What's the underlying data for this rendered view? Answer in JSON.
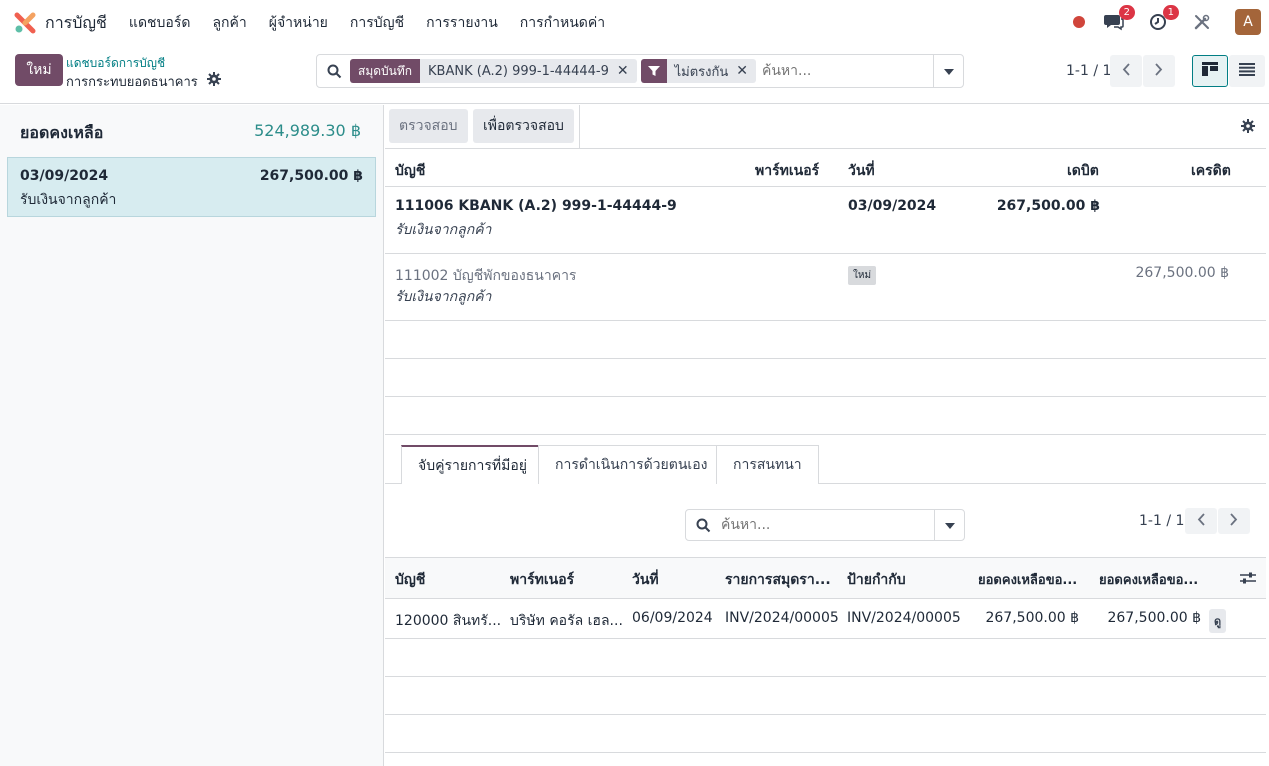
{
  "topbar": {
    "app_title": "การบัญชี",
    "menu": [
      "แดชบอร์ด",
      "ลูกค้า",
      "ผู้จำหน่าย",
      "การบัญชี",
      "การรายงาน",
      "การกำหนดค่า"
    ],
    "messages_count": "2",
    "activities_count": "1",
    "avatar_letter": "A"
  },
  "control": {
    "new_label": "ใหม่",
    "breadcrumb_parent": "แดชบอร์ดการบัญชี",
    "breadcrumb_current": "การกระทบยอดธนาคาร",
    "facets": [
      {
        "label": "สมุดบันทึก",
        "value": "KBANK (A.2) 999-1-44444-9"
      },
      {
        "label": "",
        "value": "ไม่ตรงกัน"
      }
    ],
    "search_placeholder": "ค้นหา...",
    "pager": "1-1 / 1"
  },
  "left": {
    "balance_label": "ยอดคงเหลือ",
    "balance_value": "524,989.30 ฿",
    "statement": {
      "date": "03/09/2024",
      "amount": "267,500.00 ฿",
      "label": "รับเงินจากลูกค้า"
    }
  },
  "right": {
    "btn_validate": "ตรวจสอบ",
    "btn_to_check": "เพื่อตรวจสอบ",
    "headers": {
      "account": "บัญชี",
      "partner": "พาร์ทเนอร์",
      "date": "วันที่",
      "debit": "เดบิต",
      "credit": "เครดิต"
    },
    "rows": [
      {
        "account": "111006 KBANK (A.2) 999-1-44444-9",
        "label": "รับเงินจากลูกค้า",
        "date": "03/09/2024",
        "debit": "267,500.00 ฿",
        "credit": ""
      },
      {
        "account": "111002 บัญชีพักของธนาคาร",
        "label": "รับเงินจากลูกค้า",
        "badge": "ใหม่",
        "debit": "",
        "credit": "267,500.00 ฿"
      }
    ],
    "tabs": [
      "จับคู่รายการที่มีอยู่",
      "การดำเนินการด้วยตนเอง",
      "การสนทนา"
    ],
    "search_placeholder": "ค้นหา...",
    "pager": "1-1 / 1",
    "table2_headers": [
      "บัญชี",
      "พาร์ทเนอร์",
      "วันที่",
      "รายการสมุดรา...",
      "ป้ายกำกับ",
      "ยอดคงเหลือขอ...",
      "ยอดคงเหลือขอ..."
    ],
    "table2_row": {
      "account": "120000 สินทรั...",
      "partner": "บริษัท คอรัล เฮล...",
      "date": "06/09/2024",
      "entry": "INV/2024/00005",
      "label": "INV/2024/00005",
      "amount1": "267,500.00 ฿",
      "amount2": "267,500.00 ฿",
      "view": "ดู"
    }
  }
}
